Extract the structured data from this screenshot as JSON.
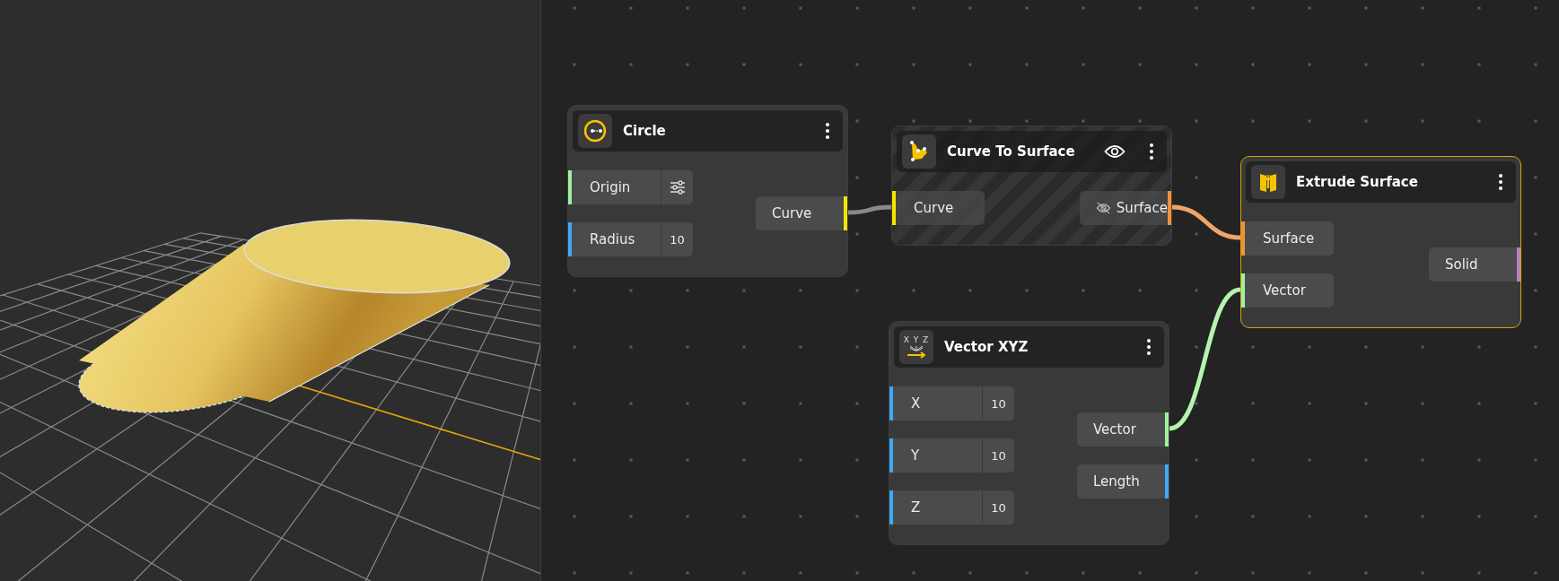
{
  "nodes": [
    {
      "title": "Circle",
      "selected": false,
      "preview_hidden": false,
      "inputs": [
        {
          "label": "Origin",
          "color": "#9ef09e",
          "kind": "settings"
        },
        {
          "label": "Radius",
          "color": "#3fa9f5",
          "kind": "value",
          "value": "10"
        }
      ],
      "outputs": [
        {
          "label": "Curve",
          "color": "#f2e600",
          "hidden": false
        }
      ]
    },
    {
      "title": "Curve To Surface",
      "selected": false,
      "preview_hidden": true,
      "inputs": [
        {
          "label": "Curve",
          "color": "#f2e600",
          "kind": "plain"
        }
      ],
      "outputs": [
        {
          "label": "Surface",
          "color": "#f0913a",
          "hidden": true
        }
      ]
    },
    {
      "title": "Extrude Surface",
      "selected": true,
      "preview_hidden": false,
      "inputs": [
        {
          "label": "Surface",
          "color": "#f0913a",
          "kind": "plain"
        },
        {
          "label": "Vector",
          "color": "#9ef09e",
          "kind": "plain"
        }
      ],
      "outputs": [
        {
          "label": "Solid",
          "color": "#b585b5",
          "hidden": false
        }
      ]
    },
    {
      "title": "Vector XYZ",
      "icon_text": "X Y Z",
      "selected": false,
      "preview_hidden": false,
      "inputs": [
        {
          "label": "X",
          "color": "#3fa9f5",
          "kind": "value",
          "value": "10"
        },
        {
          "label": "Y",
          "color": "#3fa9f5",
          "kind": "value",
          "value": "10"
        },
        {
          "label": "Z",
          "color": "#3fa9f5",
          "kind": "value",
          "value": "10"
        }
      ],
      "outputs": [
        {
          "label": "Vector",
          "color": "#9ef09e",
          "hidden": false
        },
        {
          "label": "Length",
          "color": "#3fa9f5",
          "hidden": false
        }
      ]
    }
  ]
}
